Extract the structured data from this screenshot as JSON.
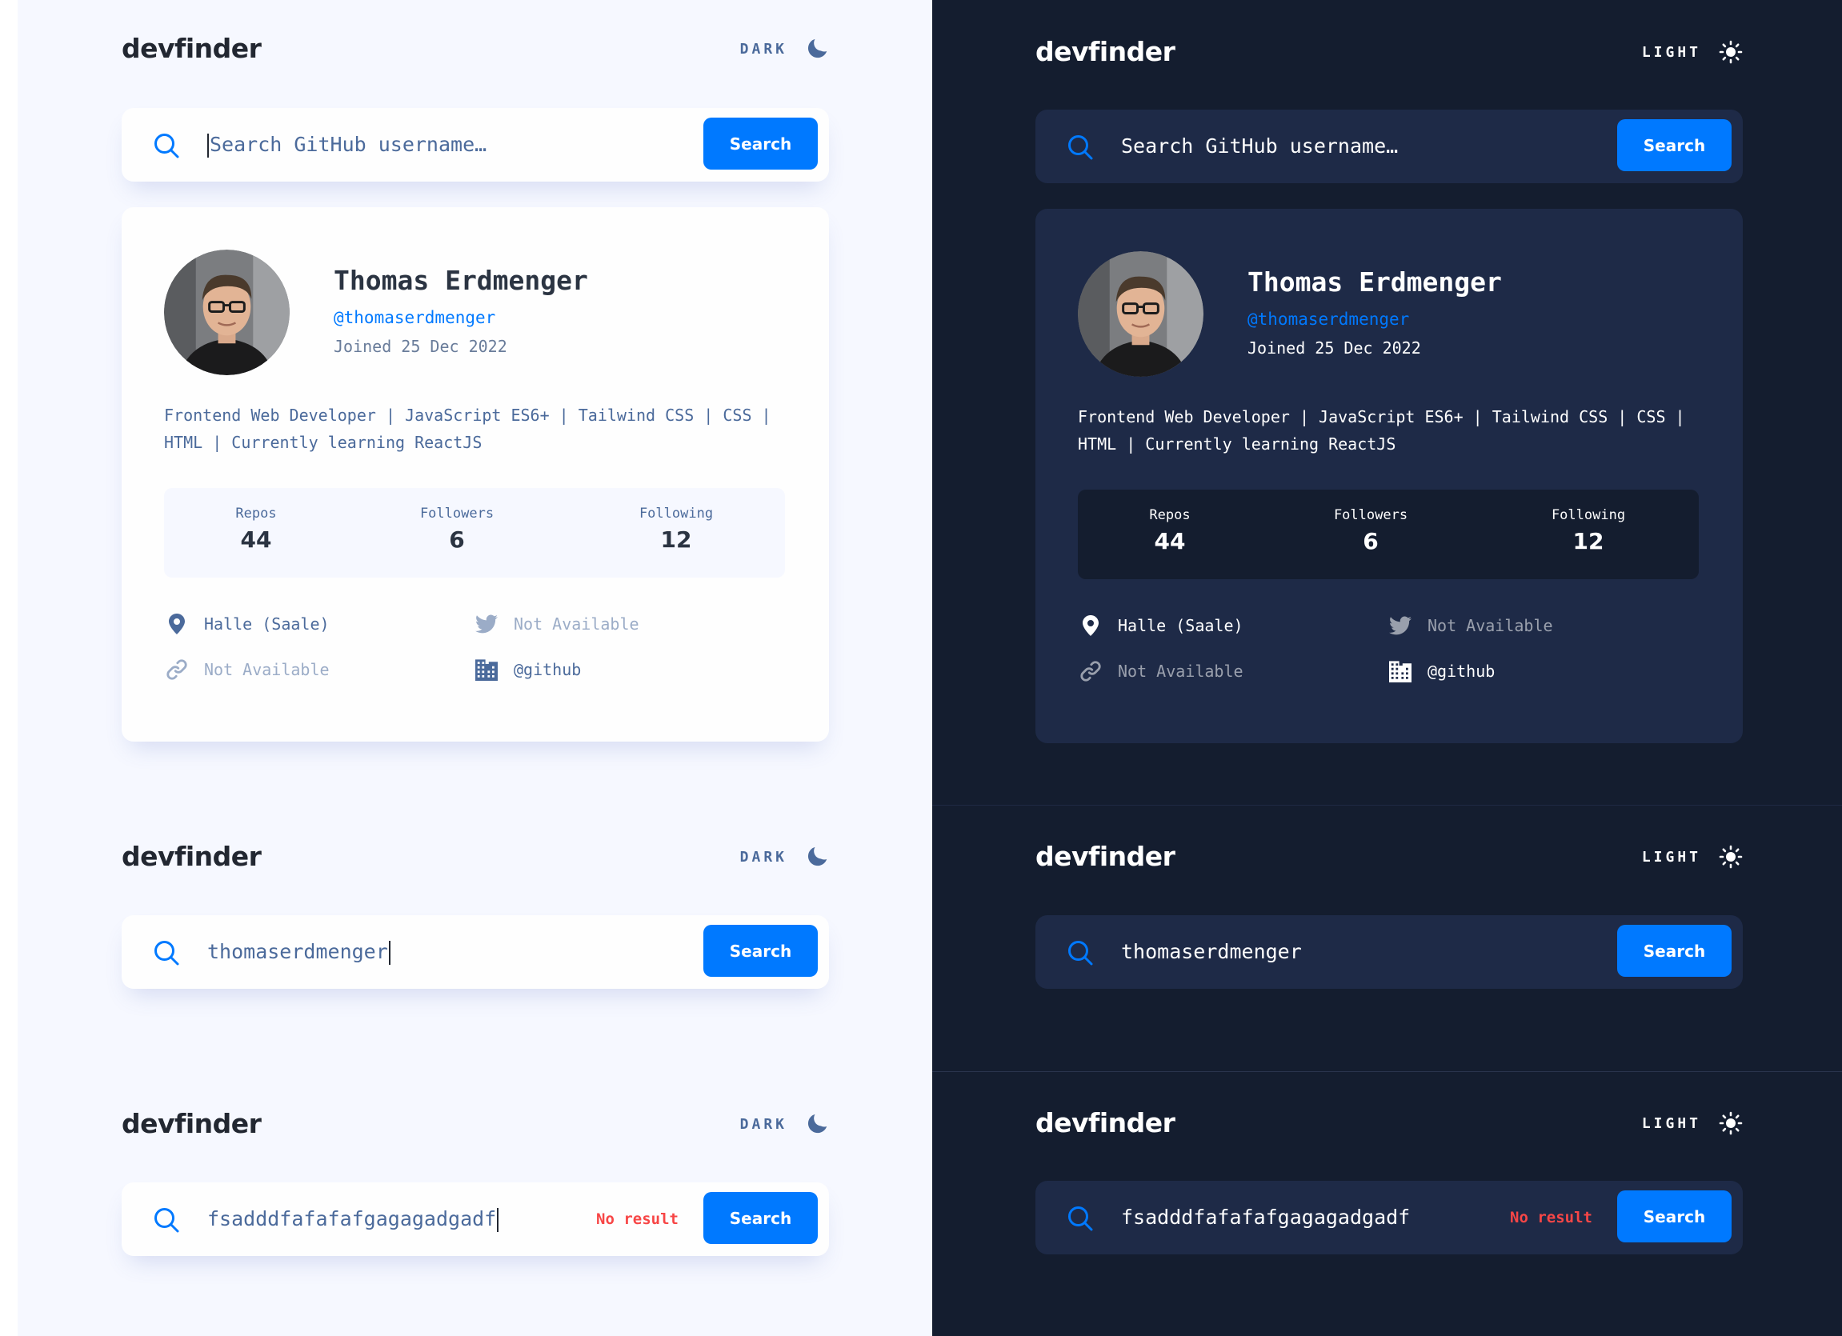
{
  "app": {
    "logo": "devfinder"
  },
  "light_theme": {
    "toggle_label": "DARK"
  },
  "dark_theme": {
    "toggle_label": "LIGHT"
  },
  "search": {
    "placeholder": "Search GitHub username…",
    "button_label": "Search",
    "typed_value": "thomaserdmenger",
    "invalid_value": "fsadddfafafafgagagadgadf",
    "no_result_label": "No result"
  },
  "profile": {
    "name": "Thomas Erdmenger",
    "login": "@thomaserdmenger",
    "joined": "Joined 25 Dec 2022",
    "bio": "Frontend Web Developer | JavaScript ES6+ | Tailwind CSS | CSS | HTML | Currently learning ReactJS",
    "stats": [
      {
        "label": "Repos",
        "value": "44"
      },
      {
        "label": "Followers",
        "value": "6"
      },
      {
        "label": "Following",
        "value": "12"
      }
    ],
    "location": "Halle (Saale)",
    "twitter": "Not Available",
    "blog": "Not Available",
    "company": "@github"
  },
  "colors": {
    "accent": "#0079ff",
    "light_bg": "#f6f8ff",
    "dark_bg": "#141d2f",
    "dark_card": "#1e2a47",
    "error": "#f74646"
  },
  "icons": [
    "moon-icon",
    "sun-icon",
    "search-icon",
    "location-icon",
    "twitter-icon",
    "link-icon",
    "company-icon"
  ]
}
